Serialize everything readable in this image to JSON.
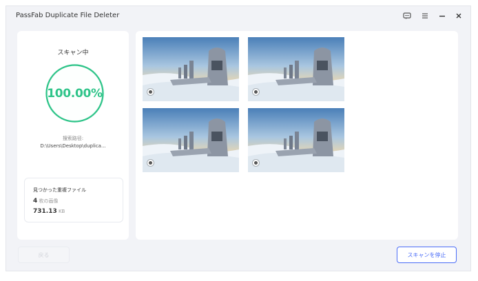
{
  "app": {
    "title": "PassFab Duplicate File Deleter"
  },
  "scan": {
    "status": "スキャン中",
    "progress_text": "100.00%",
    "progress_fraction": 1.0,
    "path_label": "搜索路径:",
    "path_value": "D:\\Users\\Desktop\\duplica..."
  },
  "found": {
    "title": "見つかった重複ファイル",
    "count": "4",
    "count_unit": "枚の画像",
    "size": "731.13",
    "size_unit": "KB"
  },
  "buttons": {
    "back": "戻る",
    "stop": "スキャンを停止"
  },
  "thumbnails": [
    {
      "name": "image-1",
      "selected": false
    },
    {
      "name": "image-2",
      "selected": false
    },
    {
      "name": "image-3",
      "selected": false
    },
    {
      "name": "image-4",
      "selected": false
    }
  ],
  "colors": {
    "accent": "#2ec489",
    "primary": "#4a6cf7",
    "background": "#f2f3f7"
  },
  "icons": [
    "feedback-icon",
    "menu-icon",
    "minimize-icon",
    "close-icon"
  ]
}
